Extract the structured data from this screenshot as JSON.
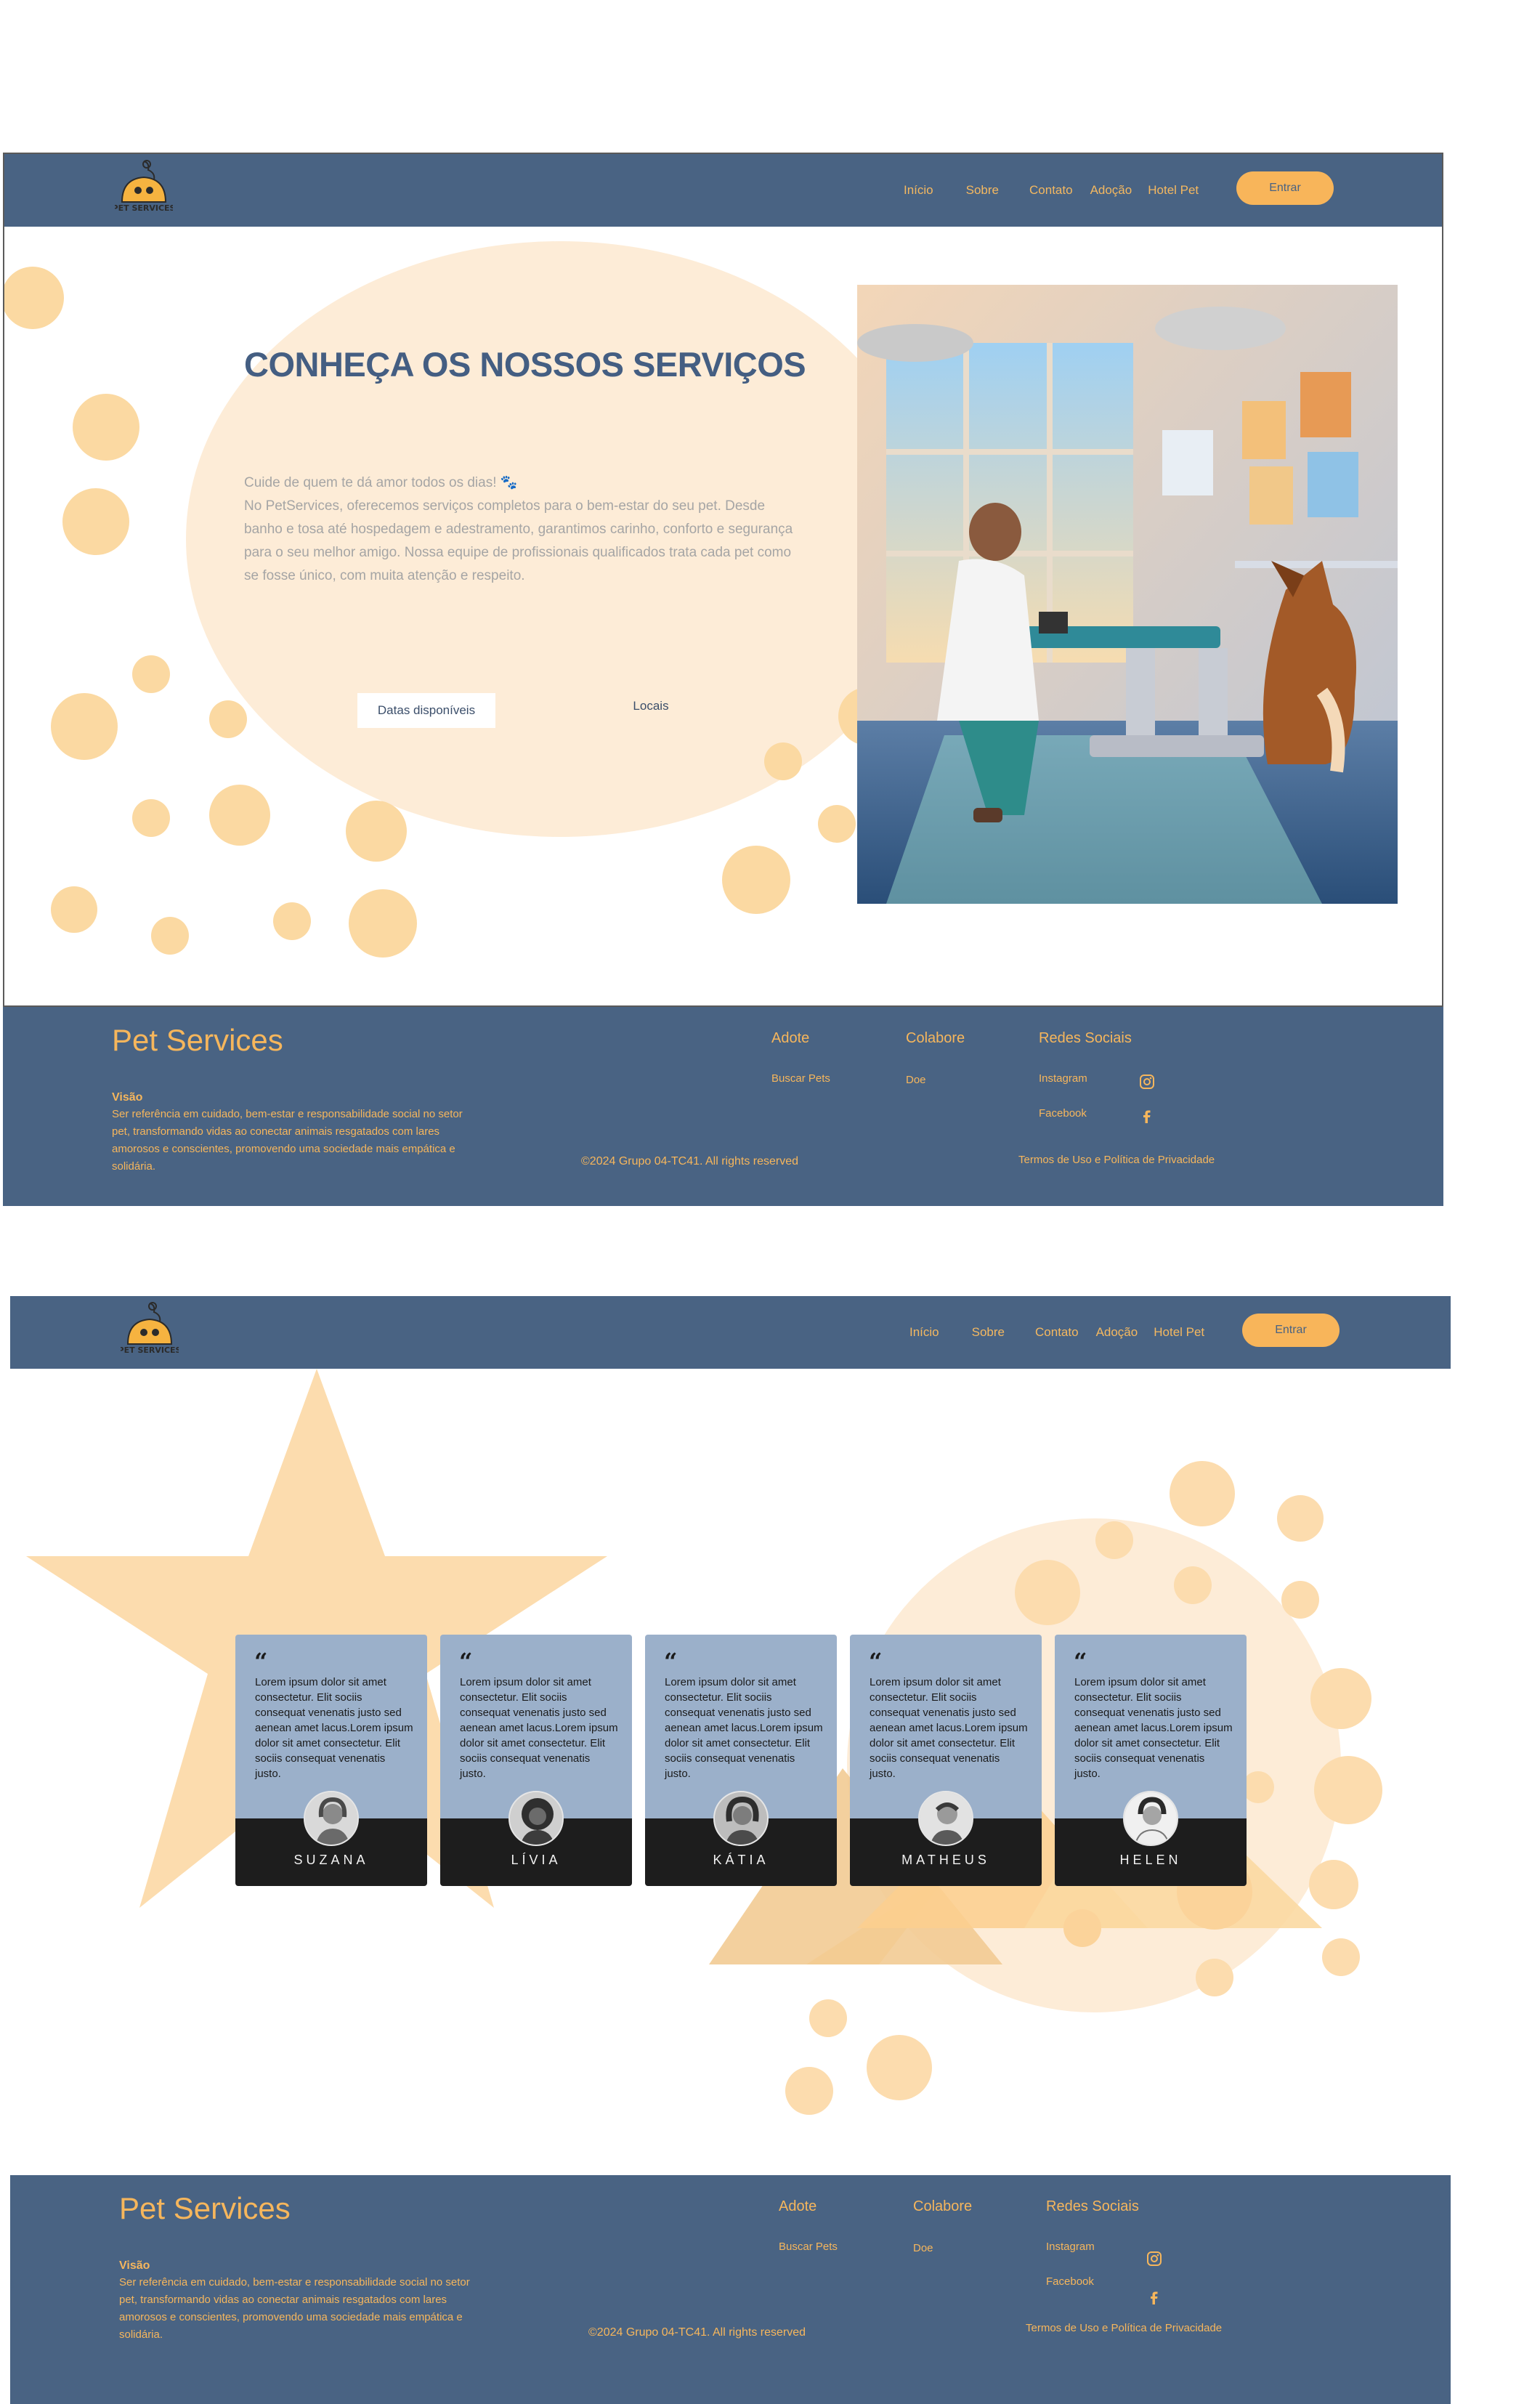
{
  "brand": {
    "logo_text": "PET SERVICES"
  },
  "nav": {
    "links": [
      "Início",
      "Sobre",
      "Contato",
      "Adoção",
      "Hotel Pet"
    ],
    "login_label": "Entrar"
  },
  "hero": {
    "title": "CONHEÇA OS NOSSOS SERVIÇOS",
    "intro": "Cuide de quem te dá amor todos os dias! 🐾",
    "paragraph": "No PetServices, oferecemos serviços completos para o bem-estar do seu pet. Desde banho e tosa até hospedagem e adestramento, garantimos carinho, conforto e segurança para o seu melhor amigo. Nossa equipe de profissionais qualificados trata cada pet como se fosse único, com muita atenção e respeito.",
    "button_dates": "Datas disponíveis",
    "button_locations": "Locais"
  },
  "footer": {
    "brand": "Pet Services",
    "vision_title": "Visão",
    "vision_text": "Ser referência em cuidado, bem-estar e responsabilidade social no setor pet, transformando vidas ao conectar animais resgatados com lares amorosos e conscientes, promovendo uma sociedade mais empática e solidária.",
    "adote_title": "Adote",
    "adote_link": "Buscar Pets",
    "colabore_title": "Colabore",
    "colabore_link": "Doe",
    "social_title": "Redes Sociais",
    "social_instagram": "Instagram",
    "social_facebook": "Facebook",
    "copyright": "©2024 Grupo 04-TC41. All rights reserved",
    "terms": "Termos de Uso e Política de Privacidade"
  },
  "testimonials": [
    {
      "quote_mark": "“",
      "text": "Lorem ipsum dolor sit amet consectetur. Elit sociis consequat venenatis justo sed aenean amet lacus.Lorem ipsum dolor sit amet consectetur. Elit sociis consequat venenatis justo.",
      "name": "SUZANA"
    },
    {
      "quote_mark": "“",
      "text": "Lorem ipsum dolor sit amet consectetur. Elit sociis consequat venenatis justo sed aenean amet lacus.Lorem ipsum dolor sit amet consectetur. Elit sociis consequat venenatis justo.",
      "name": "LÍVIA"
    },
    {
      "quote_mark": "“",
      "text": "Lorem ipsum dolor sit amet consectetur. Elit sociis consequat venenatis justo sed aenean amet lacus.Lorem ipsum dolor sit amet consectetur. Elit sociis consequat venenatis justo.",
      "name": "KÁTIA"
    },
    {
      "quote_mark": "“",
      "text": "Lorem ipsum dolor sit amet consectetur. Elit sociis consequat venenatis justo sed aenean amet lacus.Lorem ipsum dolor sit amet consectetur. Elit sociis consequat venenatis justo.",
      "name": "MATHEUS"
    },
    {
      "quote_mark": "“",
      "text": "Lorem ipsum dolor sit amet consectetur. Elit sociis consequat venenatis justo sed aenean amet lacus.Lorem ipsum dolor sit amet consectetur. Elit sociis consequat venenatis justo.",
      "name": "HELEN"
    }
  ],
  "icons": {
    "instagram": "instagram-icon",
    "facebook": "facebook-icon"
  },
  "colors": {
    "navy": "#496383",
    "orange": "#f8b55a",
    "peach": "#fdecd7",
    "card": "#9bb0ca"
  }
}
